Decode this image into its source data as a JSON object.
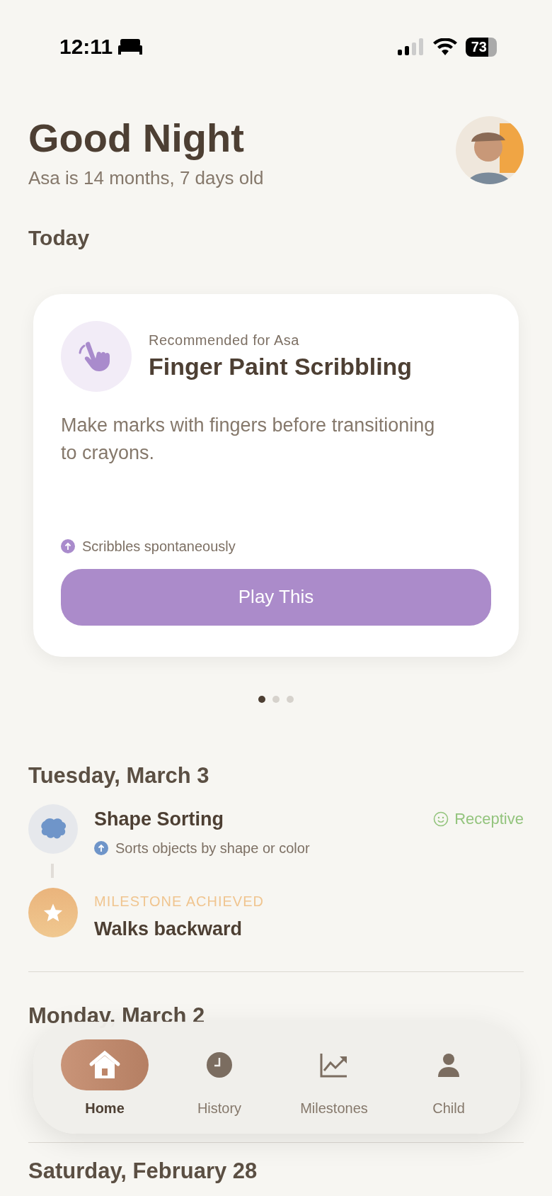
{
  "status_bar": {
    "time": "12:11",
    "battery": "73"
  },
  "header": {
    "greeting": "Good Night",
    "subtitle": "Asa is 14 months, 7 days old"
  },
  "today": {
    "heading": "Today",
    "card": {
      "eyebrow": "Recommended for Asa",
      "title": "Finger Paint Scribbling",
      "description": "Make marks with fingers before transitioning to crayons.",
      "skill": "Scribbles spontaneously",
      "button": "Play This"
    },
    "pager": [
      {
        "selected": true
      },
      {
        "selected": false
      },
      {
        "selected": false
      }
    ]
  },
  "days": [
    {
      "heading": "Tuesday, March 3",
      "entries": [
        {
          "kind": "activity",
          "title": "Shape Sorting",
          "skill": "Sorts objects by shape or color",
          "response": "Receptive"
        },
        {
          "kind": "milestone",
          "label": "MILESTONE ACHIEVED",
          "title": "Walks backward"
        }
      ]
    },
    {
      "heading": "Monday, March 2"
    },
    {
      "heading": "Saturday, February 28"
    }
  ],
  "tab_bar": [
    {
      "label": "Home",
      "selected": true
    },
    {
      "label": "History",
      "selected": false
    },
    {
      "label": "Milestones",
      "selected": false
    },
    {
      "label": "Child",
      "selected": false
    }
  ]
}
